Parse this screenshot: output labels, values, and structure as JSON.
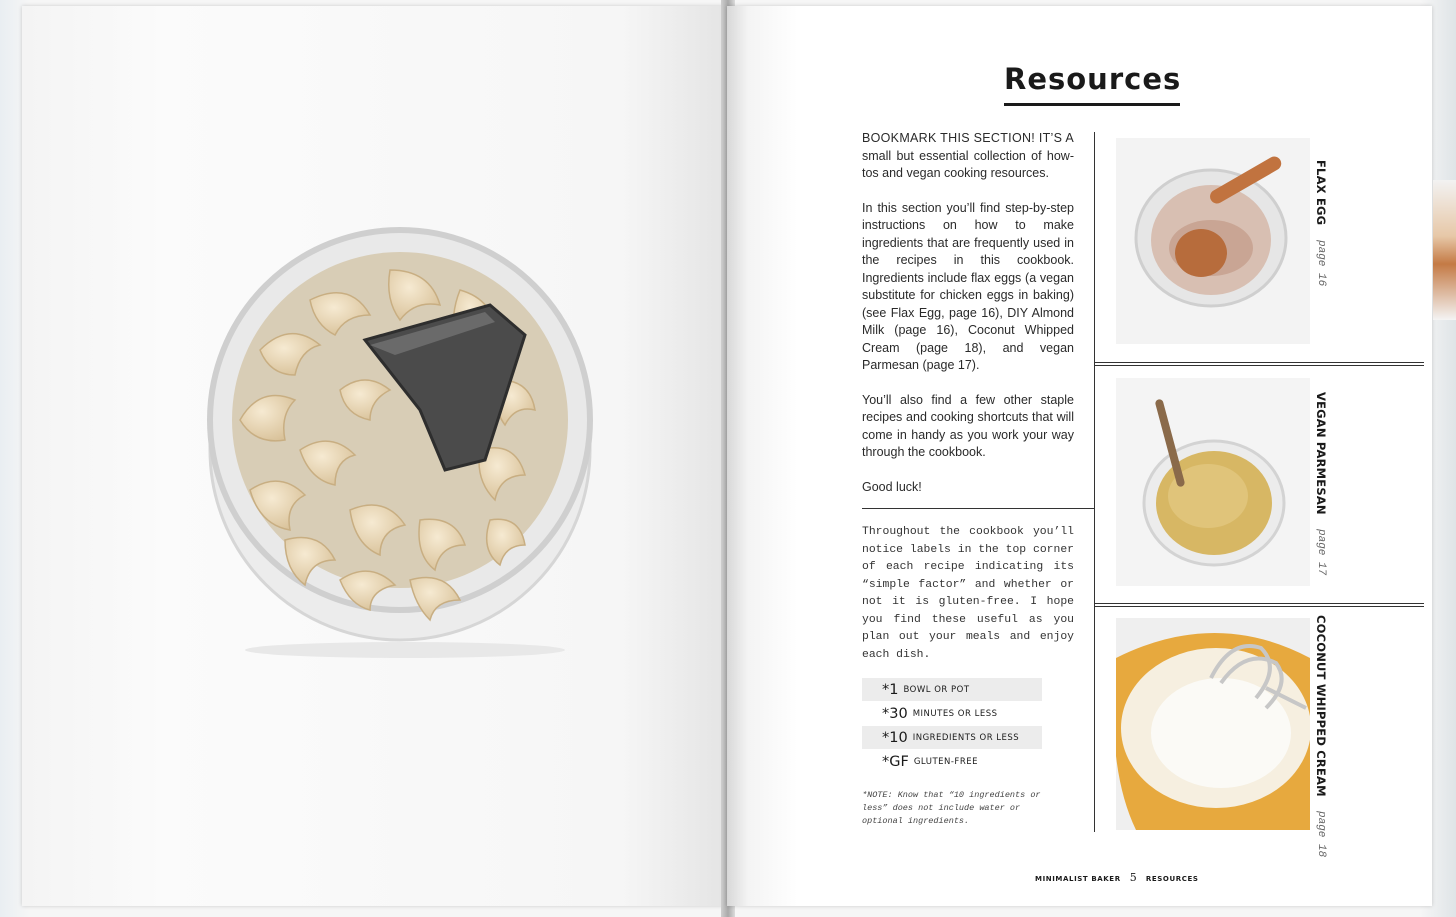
{
  "page": {
    "title": "Resources",
    "intro": {
      "lead_caps": "BOOKMARK THIS SECTION! IT’S A",
      "lead_rest": "small but essential collection of how-tos and vegan cooking resources.",
      "para2": "In this section you’ll find step-by-step instructions on how to make ingredients that are frequently used in the recipes in this cookbook. Ingredients include flax eggs (a vegan substitute for chicken eggs in baking) (see Flax Egg, page 16), DIY Almond Milk (page 16), Coconut Whipped Cream (page 18), and vegan Parmesan (page 17).",
      "para3": "You’ll also find a few other staple recipes and cooking shortcuts that will come in handy as you work your way through the cookbook.",
      "para4": "Good luck!"
    },
    "labels_note": "Throughout the cookbook you’ll notice labels in the top corner of each recipe indicating its “simple factor” and whether or not it is gluten-free. I hope you find these useful as you plan out your meals and enjoy each dish.",
    "legend": [
      {
        "code": "*1",
        "text": "BOWL OR POT"
      },
      {
        "code": "*30",
        "text": "MINUTES OR LESS"
      },
      {
        "code": "*10",
        "text": "INGREDIENTS OR LESS"
      },
      {
        "code": "*GF",
        "text": "GLUTEN-FREE"
      }
    ],
    "footnote": "*NOTE: Know that “10 ingredients or less” does not include water or optional ingredients.",
    "photos": [
      {
        "name": "FLAX EGG",
        "page": "page 16"
      },
      {
        "name": "VEGAN PARMESAN",
        "page": "page 17"
      },
      {
        "name": "COCONUT WHIPPED CREAM",
        "page": "page 18"
      }
    ],
    "footer": {
      "left": "MINIMALIST BAKER",
      "number": "5",
      "right": "RESOURCES"
    }
  },
  "colors": {
    "ink": "#1a1a1a",
    "page": "#ffffff",
    "rule": "#333333",
    "legend_shade": "#ececec"
  }
}
